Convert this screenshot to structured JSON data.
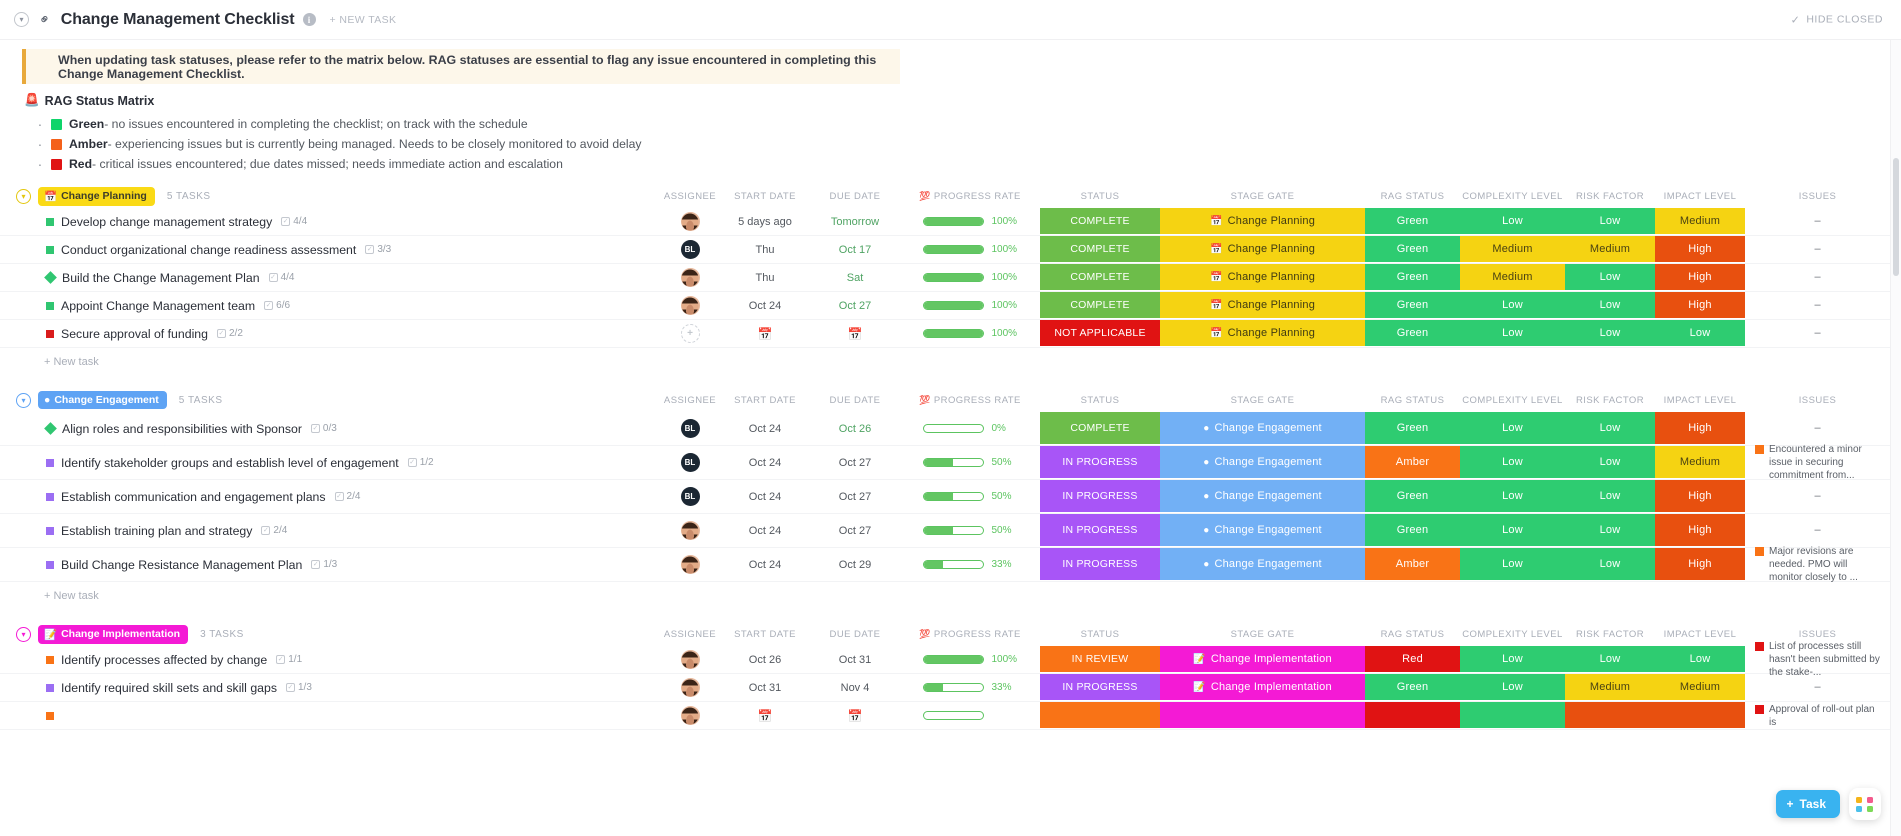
{
  "topbar": {
    "title": "Change Management Checklist",
    "new_task_label": "+ NEW TASK",
    "hide_closed_label": "HIDE CLOSED",
    "info_glyph": "i",
    "chevron_glyph": "▾",
    "check_glyph": "✓",
    "link_glyph": "⚭"
  },
  "banner": {
    "text": "When updating task statuses, please refer to the matrix below. RAG statuses are essential to flag any issue encountered in completing this Change Management Checklist.",
    "accent_color": "#e8a93b",
    "bg_color": "#fdf7ea"
  },
  "legend": {
    "title": "RAG Status Matrix",
    "title_icon": "🚨",
    "items": [
      {
        "name": "Green",
        "color": "#0fd46a",
        "desc": " - no issues encountered in completing the checklist; on track with the schedule"
      },
      {
        "name": "Amber",
        "color": "#f4611a",
        "desc": " - experiencing issues but is currently being managed. Needs to be closely monitored to avoid delay"
      },
      {
        "name": "Red",
        "color": "#e01313",
        "desc": " - critical issues encountered; due dates missed; needs immediate action and escalation"
      }
    ]
  },
  "columns": {
    "assignee": "ASSIGNEE",
    "start_date": "START DATE",
    "due_date": "DUE DATE",
    "progress_rate": "PROGRESS RATE",
    "progress_icon": "💯",
    "status": "STATUS",
    "stage_gate": "STAGE GATE",
    "rag_status": "RAG STATUS",
    "complexity_level": "COMPLEXITY LEVEL",
    "risk_factor": "RISK FACTOR",
    "impact_level": "IMPACT LEVEL",
    "issues": "ISSUES",
    "add_column": "+"
  },
  "new_task_row_label": "+ New task",
  "fab": {
    "task_label": "Task",
    "plus": "+"
  },
  "groups": [
    {
      "name": "Change Planning",
      "icon": "📅",
      "pill_bg": "#fada16",
      "pill_color": "#3d3d2a",
      "chevron_color": "#e3c70f",
      "count": "5 TASKS",
      "tasks": [
        {
          "priority_color": "#30c671",
          "priority_shape": "square",
          "name": "Develop change management strategy",
          "subtasks": "4/4",
          "assignee": {
            "type": "photo",
            "initials": ""
          },
          "start": "5 days ago",
          "due": "Tomorrow",
          "due_style": "due",
          "progress": 100,
          "progress_label": "100%",
          "status": "COMPLETE",
          "status_bg": "#6dbd4a",
          "stage": "Change Planning",
          "stage_bg": "#f5d312",
          "stage_color": "#3f3a13",
          "stage_icon": "📅",
          "rag": "Green",
          "rag_bg": "#2ecc71",
          "complexity": "Low",
          "complexity_bg": "#2ecc71",
          "risk": "Low",
          "risk_bg": "#2ecc71",
          "impact": "Medium",
          "impact_bg": "#f5d312",
          "impact_color": "#4a4212",
          "issue": "",
          "issue_color": ""
        },
        {
          "priority_color": "#30c671",
          "priority_shape": "square",
          "name": "Conduct organizational change readiness assessment",
          "subtasks": "3/3",
          "assignee": {
            "type": "initials",
            "initials": "BL"
          },
          "start": "Thu",
          "due": "Oct 17",
          "due_style": "due",
          "progress": 100,
          "progress_label": "100%",
          "status": "COMPLETE",
          "status_bg": "#6dbd4a",
          "stage": "Change Planning",
          "stage_bg": "#f5d312",
          "stage_color": "#3f3a13",
          "stage_icon": "📅",
          "rag": "Green",
          "rag_bg": "#2ecc71",
          "complexity": "Medium",
          "complexity_bg": "#f5d312",
          "complexity_color": "#4a4212",
          "risk": "Medium",
          "risk_bg": "#f5d312",
          "risk_color": "#4a4212",
          "impact": "High",
          "impact_bg": "#e8500f",
          "issue": "",
          "issue_color": ""
        },
        {
          "priority_color": "#30c671",
          "priority_shape": "diamond",
          "name": "Build the Change Management Plan",
          "subtasks": "4/4",
          "assignee": {
            "type": "photo",
            "initials": ""
          },
          "start": "Thu",
          "due": "Sat",
          "due_style": "due",
          "progress": 100,
          "progress_label": "100%",
          "status": "COMPLETE",
          "status_bg": "#6dbd4a",
          "stage": "Change Planning",
          "stage_bg": "#f5d312",
          "stage_color": "#3f3a13",
          "stage_icon": "📅",
          "rag": "Green",
          "rag_bg": "#2ecc71",
          "complexity": "Medium",
          "complexity_bg": "#f5d312",
          "complexity_color": "#4a4212",
          "risk": "Low",
          "risk_bg": "#2ecc71",
          "impact": "High",
          "impact_bg": "#e8500f",
          "issue": "",
          "issue_color": ""
        },
        {
          "priority_color": "#30c671",
          "priority_shape": "square",
          "name": "Appoint Change Management team",
          "subtasks": "6/6",
          "assignee": {
            "type": "photo",
            "initials": ""
          },
          "start": "Oct 24",
          "due": "Oct 27",
          "due_style": "due",
          "progress": 100,
          "progress_label": "100%",
          "status": "COMPLETE",
          "status_bg": "#6dbd4a",
          "stage": "Change Planning",
          "stage_bg": "#f5d312",
          "stage_color": "#3f3a13",
          "stage_icon": "📅",
          "rag": "Green",
          "rag_bg": "#2ecc71",
          "complexity": "Low",
          "complexity_bg": "#2ecc71",
          "risk": "Low",
          "risk_bg": "#2ecc71",
          "impact": "High",
          "impact_bg": "#e8500f",
          "issue": "",
          "issue_color": ""
        },
        {
          "priority_color": "#d91c1c",
          "priority_shape": "square",
          "name": "Secure approval of funding",
          "subtasks": "2/2",
          "assignee": {
            "type": "empty",
            "initials": ""
          },
          "start": "",
          "due": "",
          "due_style": "icon",
          "progress": 100,
          "progress_label": "100%",
          "status": "NOT APPLICABLE",
          "status_bg": "#e01313",
          "stage": "Change Planning",
          "stage_bg": "#f5d312",
          "stage_color": "#3f3a13",
          "stage_icon": "📅",
          "rag": "Green",
          "rag_bg": "#2ecc71",
          "complexity": "Low",
          "complexity_bg": "#2ecc71",
          "risk": "Low",
          "risk_bg": "#2ecc71",
          "impact": "Low",
          "impact_bg": "#2ecc71",
          "issue": "",
          "issue_color": ""
        }
      ]
    },
    {
      "name": "Change Engagement",
      "icon": "●",
      "pill_bg": "#5ea3f4",
      "pill_color": "#ffffff",
      "chevron_color": "#5ea3f4",
      "count": "5 TASKS",
      "tasks": [
        {
          "priority_color": "#30c671",
          "priority_shape": "diamond",
          "name": "Align roles and responsibilities with Sponsor",
          "subtasks": "0/3",
          "assignee": {
            "type": "initials",
            "initials": "BL"
          },
          "start": "Oct 24",
          "due": "Oct 26",
          "due_style": "due",
          "progress": 0,
          "progress_label": "0%",
          "status": "COMPLETE",
          "status_bg": "#6dbd4a",
          "stage": "Change Engagement",
          "stage_bg": "#72b0f5",
          "stage_color": "#ffffff",
          "stage_icon": "●",
          "rag": "Green",
          "rag_bg": "#2ecc71",
          "complexity": "Low",
          "complexity_bg": "#2ecc71",
          "risk": "Low",
          "risk_bg": "#2ecc71",
          "impact": "High",
          "impact_bg": "#e8500f",
          "issue": "",
          "issue_color": ""
        },
        {
          "priority_color": "#9b6ef3",
          "priority_shape": "square",
          "name": "Identify stakeholder groups and establish level of engagement",
          "subtasks": "1/2",
          "assignee": {
            "type": "initials",
            "initials": "BL"
          },
          "start": "Oct 24",
          "due": "Oct 27",
          "due_style": "plain",
          "progress": 50,
          "progress_label": "50%",
          "status": "IN PROGRESS",
          "status_bg": "#a855f7",
          "stage": "Change Engagement",
          "stage_bg": "#72b0f5",
          "stage_color": "#ffffff",
          "stage_icon": "●",
          "rag": "Amber",
          "rag_bg": "#f97316",
          "complexity": "Low",
          "complexity_bg": "#2ecc71",
          "risk": "Low",
          "risk_bg": "#2ecc71",
          "impact": "Medium",
          "impact_bg": "#f5d312",
          "impact_color": "#4a4212",
          "issue": "Encountered a minor issue in securing commitment from...",
          "issue_color": "#f97316"
        },
        {
          "priority_color": "#9b6ef3",
          "priority_shape": "square",
          "name": "Establish communication and engagement plans",
          "subtasks": "2/4",
          "assignee": {
            "type": "initials",
            "initials": "BL"
          },
          "start": "Oct 24",
          "due": "Oct 27",
          "due_style": "plain",
          "progress": 50,
          "progress_label": "50%",
          "status": "IN PROGRESS",
          "status_bg": "#a855f7",
          "stage": "Change Engagement",
          "stage_bg": "#72b0f5",
          "stage_color": "#ffffff",
          "stage_icon": "●",
          "rag": "Green",
          "rag_bg": "#2ecc71",
          "complexity": "Low",
          "complexity_bg": "#2ecc71",
          "risk": "Low",
          "risk_bg": "#2ecc71",
          "impact": "High",
          "impact_bg": "#e8500f",
          "issue": "",
          "issue_color": ""
        },
        {
          "priority_color": "#9b6ef3",
          "priority_shape": "square",
          "name": "Establish training plan and strategy",
          "subtasks": "2/4",
          "assignee": {
            "type": "photo",
            "initials": ""
          },
          "start": "Oct 24",
          "due": "Oct 27",
          "due_style": "plain",
          "progress": 50,
          "progress_label": "50%",
          "status": "IN PROGRESS",
          "status_bg": "#a855f7",
          "stage": "Change Engagement",
          "stage_bg": "#72b0f5",
          "stage_color": "#ffffff",
          "stage_icon": "●",
          "rag": "Green",
          "rag_bg": "#2ecc71",
          "complexity": "Low",
          "complexity_bg": "#2ecc71",
          "risk": "Low",
          "risk_bg": "#2ecc71",
          "impact": "High",
          "impact_bg": "#e8500f",
          "issue": "",
          "issue_color": ""
        },
        {
          "priority_color": "#9b6ef3",
          "priority_shape": "square",
          "name": "Build Change Resistance Management Plan",
          "subtasks": "1/3",
          "assignee": {
            "type": "photo",
            "initials": ""
          },
          "start": "Oct 24",
          "due": "Oct 29",
          "due_style": "plain",
          "progress": 33,
          "progress_label": "33%",
          "status": "IN PROGRESS",
          "status_bg": "#a855f7",
          "stage": "Change Engagement",
          "stage_bg": "#72b0f5",
          "stage_color": "#ffffff",
          "stage_icon": "●",
          "rag": "Amber",
          "rag_bg": "#f97316",
          "complexity": "Low",
          "complexity_bg": "#2ecc71",
          "risk": "Low",
          "risk_bg": "#2ecc71",
          "impact": "High",
          "impact_bg": "#e8500f",
          "issue": "Major revisions are needed. PMO will monitor closely to ...",
          "issue_color": "#f97316"
        }
      ]
    },
    {
      "name": "Change Implementation",
      "icon": "📝",
      "pill_bg": "#f41ad5",
      "pill_color": "#ffffff",
      "chevron_color": "#f41ad5",
      "count": "3 TASKS",
      "tasks": [
        {
          "priority_color": "#f97316",
          "priority_shape": "square",
          "name": "Identify processes affected by change",
          "subtasks": "1/1",
          "assignee": {
            "type": "photo",
            "initials": ""
          },
          "start": "Oct 26",
          "due": "Oct 31",
          "due_style": "plain",
          "progress": 100,
          "progress_label": "100%",
          "status": "IN REVIEW",
          "status_bg": "#f97316",
          "stage": "Change Implementation",
          "stage_bg": "#f41ad5",
          "stage_color": "#ffffff",
          "stage_icon": "📝",
          "rag": "Red",
          "rag_bg": "#e01313",
          "complexity": "Low",
          "complexity_bg": "#2ecc71",
          "risk": "Low",
          "risk_bg": "#2ecc71",
          "impact": "Low",
          "impact_bg": "#2ecc71",
          "issue": "List of processes still hasn't been submitted by the stake-...",
          "issue_color": "#e01313"
        },
        {
          "priority_color": "#9b6ef3",
          "priority_shape": "square",
          "name": "Identify required skill sets and skill gaps",
          "subtasks": "1/3",
          "assignee": {
            "type": "photo",
            "initials": ""
          },
          "start": "Oct 31",
          "due": "Nov 4",
          "due_style": "plain",
          "progress": 33,
          "progress_label": "33%",
          "status": "IN PROGRESS",
          "status_bg": "#a855f7",
          "stage": "Change Implementation",
          "stage_bg": "#f41ad5",
          "stage_color": "#ffffff",
          "stage_icon": "📝",
          "rag": "Green",
          "rag_bg": "#2ecc71",
          "complexity": "Low",
          "complexity_bg": "#2ecc71",
          "risk": "Medium",
          "risk_bg": "#f5d312",
          "risk_color": "#4a4212",
          "impact": "Medium",
          "impact_bg": "#f5d312",
          "impact_color": "#4a4212",
          "issue": "",
          "issue_color": ""
        },
        {
          "priority_color": "#f97316",
          "priority_shape": "square",
          "name": "",
          "subtasks": "",
          "assignee": {
            "type": "photo",
            "initials": ""
          },
          "start": "",
          "due": "",
          "due_style": "plain",
          "progress": 0,
          "progress_label": "",
          "status": "",
          "status_bg": "#f97316",
          "stage": "",
          "stage_bg": "#f41ad5",
          "stage_color": "#ffffff",
          "stage_icon": "",
          "rag": "",
          "rag_bg": "#e01313",
          "complexity": "",
          "complexity_bg": "#2ecc71",
          "risk": "",
          "risk_bg": "#e8500f",
          "impact": "",
          "impact_bg": "#e8500f",
          "issue": "Approval of roll-out plan is",
          "issue_color": "#e01313"
        }
      ]
    }
  ]
}
